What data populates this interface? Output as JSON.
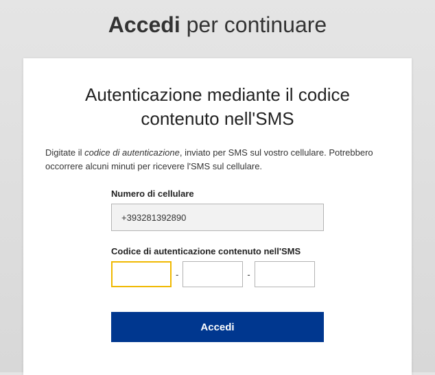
{
  "page_title": {
    "bold": "Accedi",
    "rest": " per continuare"
  },
  "card": {
    "heading": "Autenticazione mediante il codice contenuto nell'SMS",
    "instruction_pre": "Digitate il ",
    "instruction_em": "codice di autenticazione",
    "instruction_post": ", inviato per SMS sul vostro cellulare. Potrebbero occorrere alcuni minuti per ricevere l'SMS sul cellulare.",
    "phone_label": "Numero di cellulare",
    "phone_value": "+393281392890",
    "code_label": "Codice di autenticazione contenuto nell'SMS",
    "code_segments": [
      "",
      "",
      ""
    ],
    "dash": "-",
    "login_button": "Accedi"
  }
}
